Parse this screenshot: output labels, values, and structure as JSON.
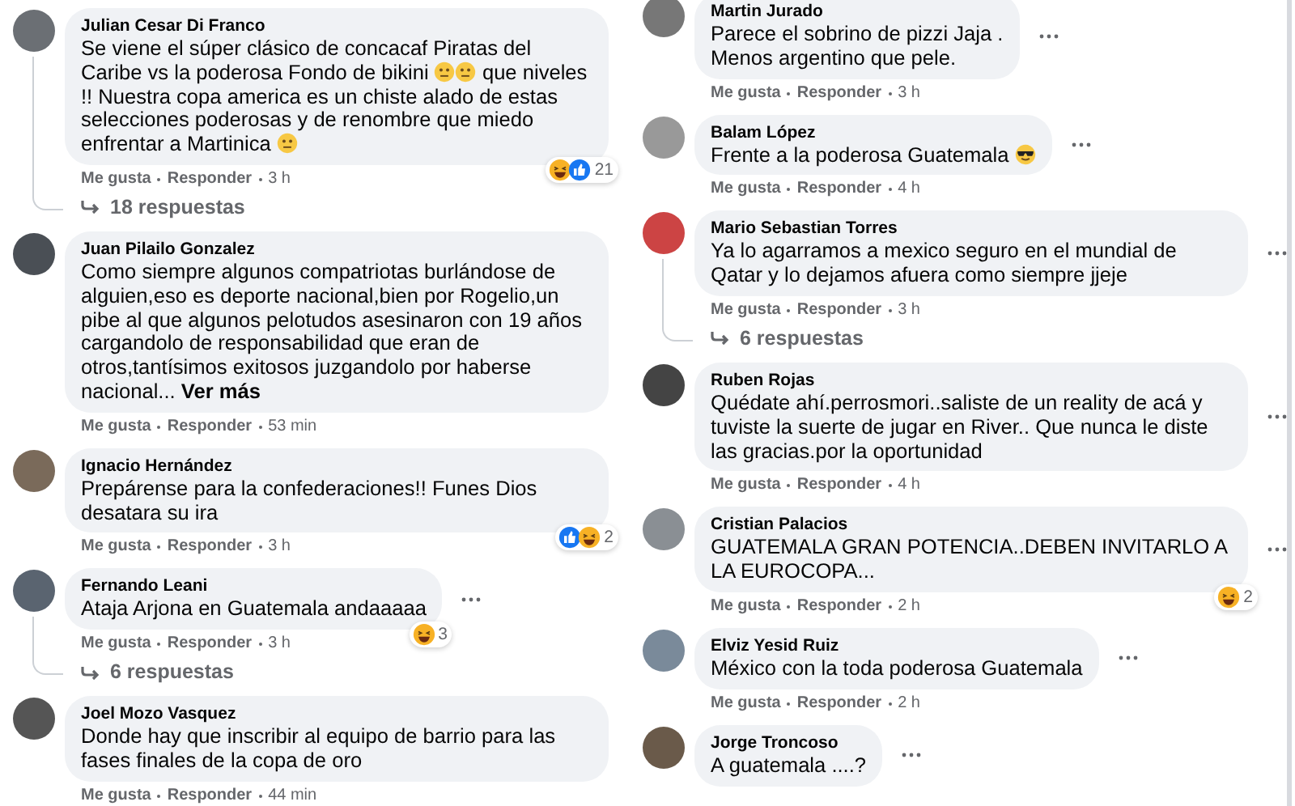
{
  "columns": [
    {
      "comments": [
        {
          "author": "Julian Cesar Di Franco",
          "body": [
            {
              "kind": "text",
              "text": "Se viene el súper clásico de concacaf Piratas del Caribe vs la poderosa Fondo de bikini "
            },
            {
              "kind": "emoji"
            },
            {
              "kind": "emoji"
            },
            {
              "kind": "text",
              "text": " que niveles !! Nuestra copa america es un chiste alado de estas selecciones poderosas y de renombre que miedo enfrentar a Martinica "
            },
            {
              "kind": "emoji"
            }
          ],
          "actions": {
            "like": "Me gusta",
            "reply": "Responder",
            "time": "3 h"
          },
          "reactions": [
            {
              "kind": "haha"
            },
            {
              "kind": "like"
            }
          ],
          "reaction_count": "21",
          "replies": "18 respuestas",
          "menu": false
        },
        {
          "author": "Juan Pilailo Gonzalez",
          "body": [
            {
              "kind": "text",
              "text": "Como siempre algunos compatriotas burlándose de alguien,eso es deporte nacional,bien por Rogelio,un pibe al que algunos pelotudos asesinaron con 19 años cargandolo de responsabilidad que eran de otros,tantísimos exitosos juzgandolo por haberse nacional... "
            },
            {
              "kind": "link",
              "text": "Ver más"
            }
          ],
          "actions": {
            "like": "Me gusta",
            "reply": "Responder",
            "time": "53 min"
          },
          "menu": false
        },
        {
          "author": "Ignacio Hernández",
          "body": [
            {
              "kind": "text",
              "text": "Prepárense para la confederaciones!! Funes Dios desatara su ira"
            }
          ],
          "actions": {
            "like": "Me gusta",
            "reply": "Responder",
            "time": "3 h"
          },
          "reactions": [
            {
              "kind": "like"
            },
            {
              "kind": "haha"
            }
          ],
          "reaction_count": "2",
          "menu": false
        },
        {
          "author": "Fernando Leani",
          "body": [
            {
              "kind": "text",
              "text": "Ataja Arjona en Guatemala andaaaaa"
            }
          ],
          "actions": {
            "like": "Me gusta",
            "reply": "Responder",
            "time": "3 h"
          },
          "reactions": [
            {
              "kind": "haha"
            }
          ],
          "reaction_count": "3",
          "replies": "6 respuestas",
          "menu": true
        },
        {
          "author": "Joel Mozo Vasquez",
          "body": [
            {
              "kind": "text",
              "text": "Donde hay que inscribir al equipo de barrio para las fases finales de la copa de oro"
            }
          ],
          "actions": {
            "like": "Me gusta",
            "reply": "Responder",
            "time": "44 min"
          },
          "menu": false
        }
      ]
    },
    {
      "comments": [
        {
          "author": "Martin Jurado",
          "body": [
            {
              "kind": "text",
              "text": "Parece el sobrino de pizzi Jaja .\nMenos argentino que pele."
            }
          ],
          "actions": {
            "like": "Me gusta",
            "reply": "Responder",
            "time": "3 h"
          },
          "menu": true
        },
        {
          "author": "Balam López",
          "body": [
            {
              "kind": "text",
              "text": "Frente a la poderosa Guatemala "
            },
            {
              "kind": "cool-emoji"
            }
          ],
          "actions": {
            "like": "Me gusta",
            "reply": "Responder",
            "time": "4 h"
          },
          "menu": true
        },
        {
          "author": "Mario Sebastian Torres",
          "body": [
            {
              "kind": "text",
              "text": "Ya lo agarramos a mexico seguro en el mundial de Qatar y lo dejamos afuera como siempre jjeje"
            }
          ],
          "actions": {
            "like": "Me gusta",
            "reply": "Responder",
            "time": "3 h"
          },
          "replies": "6 respuestas",
          "menu": true
        },
        {
          "author": "Ruben Rojas",
          "body": [
            {
              "kind": "text",
              "text": "Quédate ahí.perrosmori..saliste de un reality de acá y tuviste la suerte de jugar en River.. Que nunca le diste las gracias.por la oportunidad"
            }
          ],
          "actions": {
            "like": "Me gusta",
            "reply": "Responder",
            "time": "4 h"
          },
          "menu": true
        },
        {
          "author": "Cristian Palacios",
          "body": [
            {
              "kind": "text",
              "text": "GUATEMALA GRAN POTENCIA..DEBEN INVITARLO A LA EUROCOPA..."
            }
          ],
          "actions": {
            "like": "Me gusta",
            "reply": "Responder",
            "time": "2 h"
          },
          "reactions": [
            {
              "kind": "haha"
            }
          ],
          "reaction_count": "2",
          "menu": true
        },
        {
          "author": "Elviz Yesid Ruiz",
          "body": [
            {
              "kind": "text",
              "text": "México con la toda poderosa Guatemala"
            }
          ],
          "actions": {
            "like": "Me gusta",
            "reply": "Responder",
            "time": "2 h"
          },
          "menu": true
        },
        {
          "author": "Jorge Troncoso",
          "body": [
            {
              "kind": "text",
              "text": "A guatemala ....?"
            }
          ],
          "menu": true
        }
      ]
    }
  ]
}
